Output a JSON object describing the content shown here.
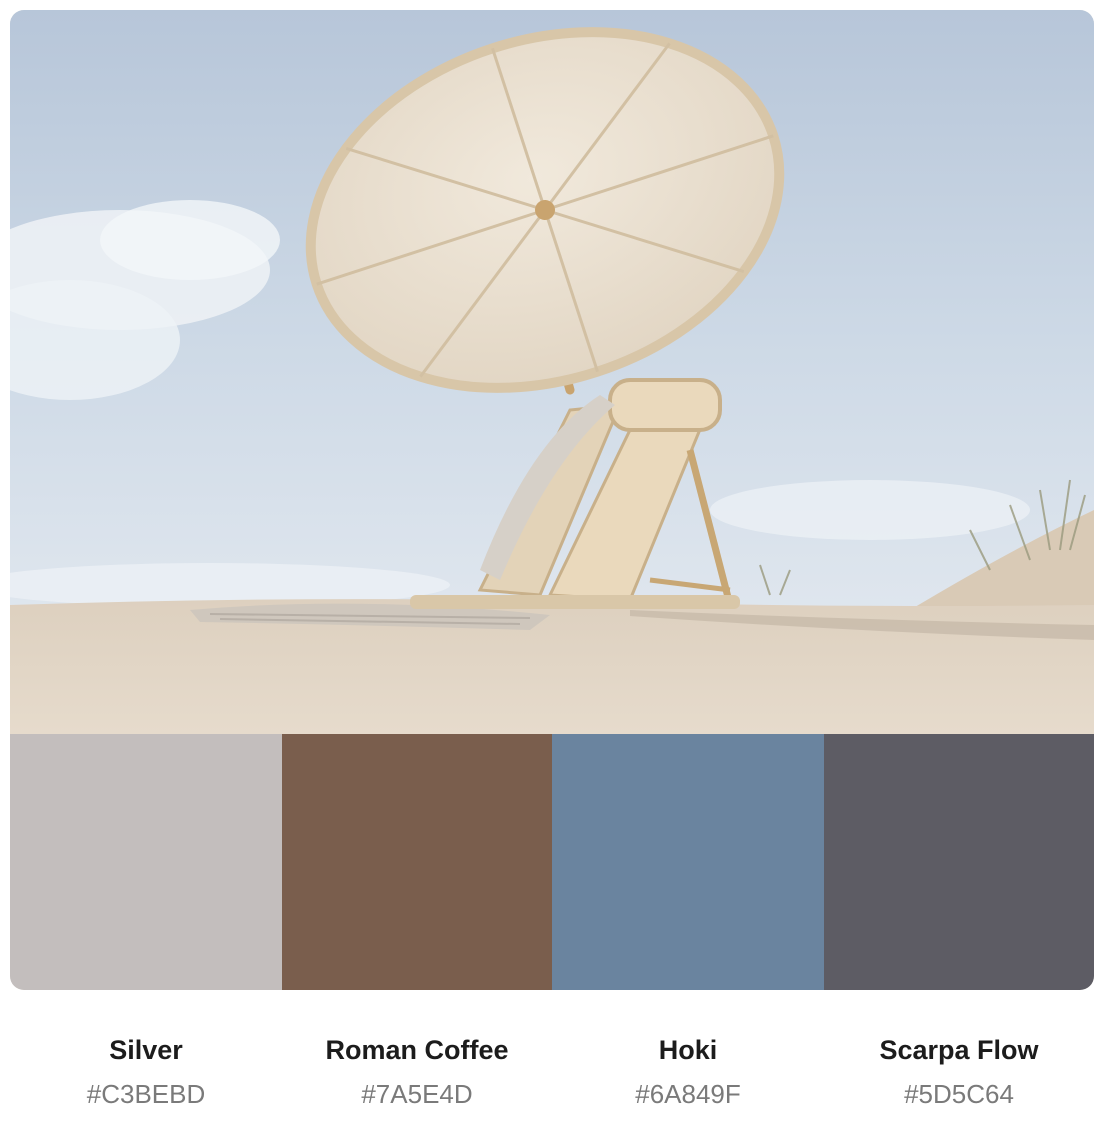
{
  "image": {
    "subject": "beach-umbrella-chair-photo"
  },
  "palette": [
    {
      "name": "Silver",
      "hex": "#C3BEBD",
      "color": "#C3BEBD"
    },
    {
      "name": "Roman Coffee",
      "hex": "#7A5E4D",
      "color": "#7A5E4D"
    },
    {
      "name": "Hoki",
      "hex": "#6A849F",
      "color": "#6A849F"
    },
    {
      "name": "Scarpa Flow",
      "hex": "#5D5C64",
      "color": "#5D5C64"
    }
  ]
}
